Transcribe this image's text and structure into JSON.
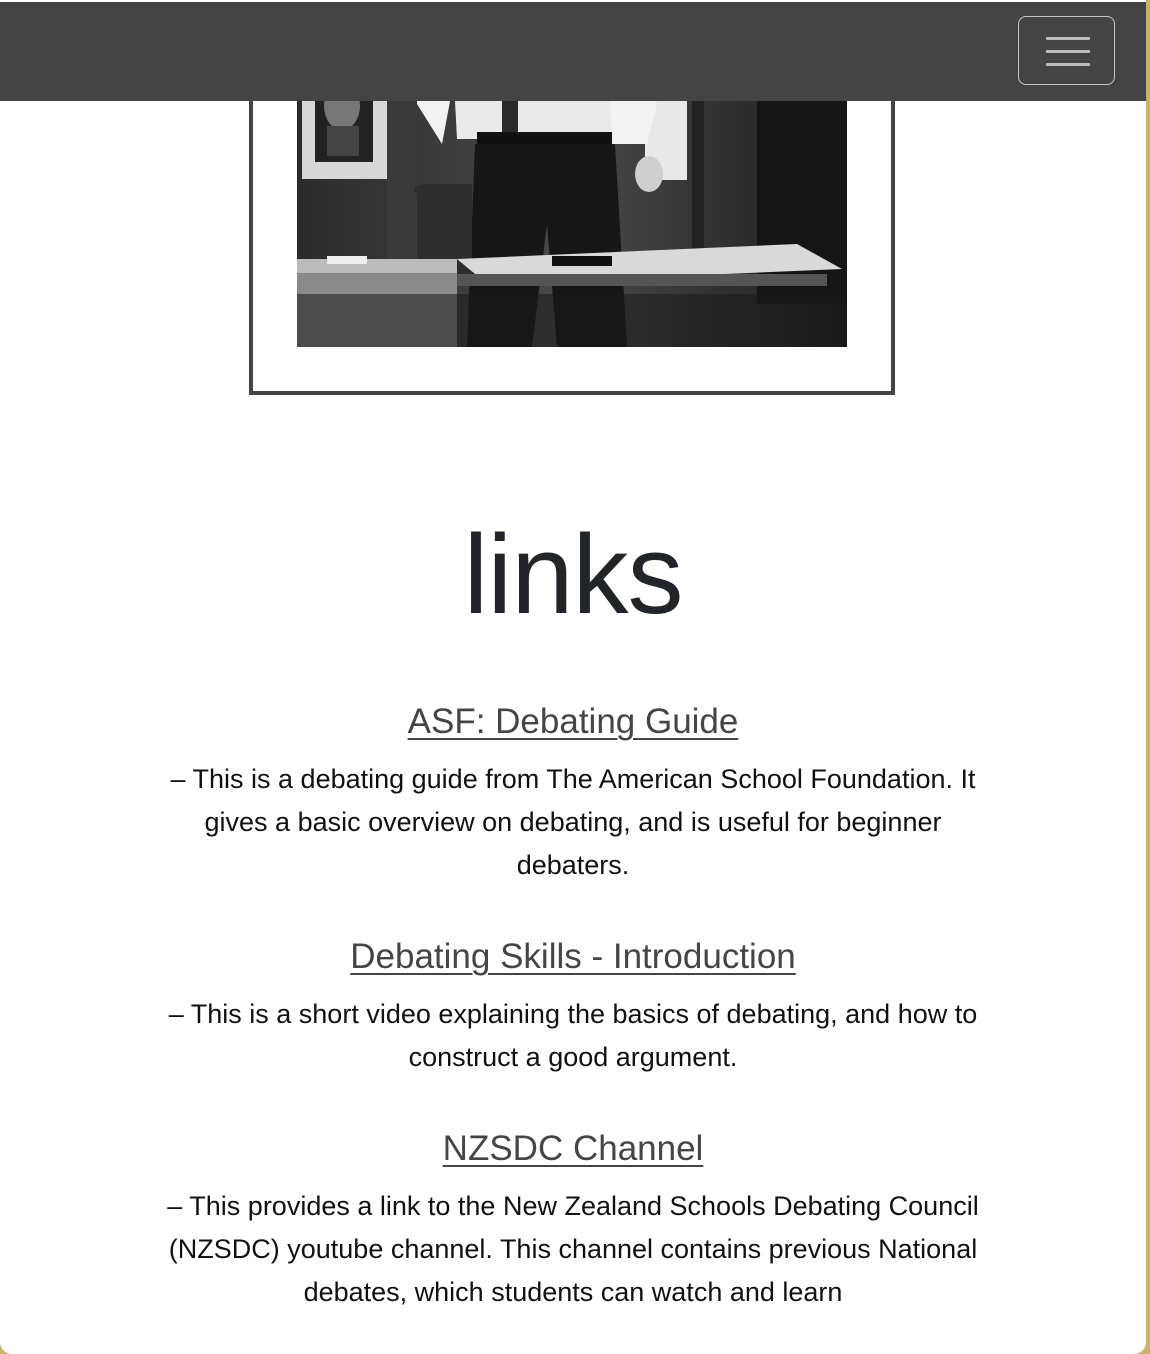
{
  "navbar": {
    "menu_icon": "hamburger-menu-icon"
  },
  "hero": {
    "image_icon": "debater-photo-image"
  },
  "section": {
    "title": "links"
  },
  "links": [
    {
      "title": "ASF: Debating Guide",
      "description": "– This is a debating guide from The American School Foundation. It gives a basic overview on debating, and is useful for beginner debaters."
    },
    {
      "title": "Debating Skills - Introduction",
      "description": "– This is a short video explaining the basics of debating, and how to construct a good argument."
    },
    {
      "title": "NZSDC Channel",
      "description": "– This provides a link to the New Zealand Schools Debating Council (NZSDC) youtube channel. This channel contains previous National debates, which students can watch and learn"
    }
  ],
  "colors": {
    "navbar": "#454445",
    "link": "#454545",
    "heading": "#212529",
    "accent_border": "#c8b464"
  }
}
